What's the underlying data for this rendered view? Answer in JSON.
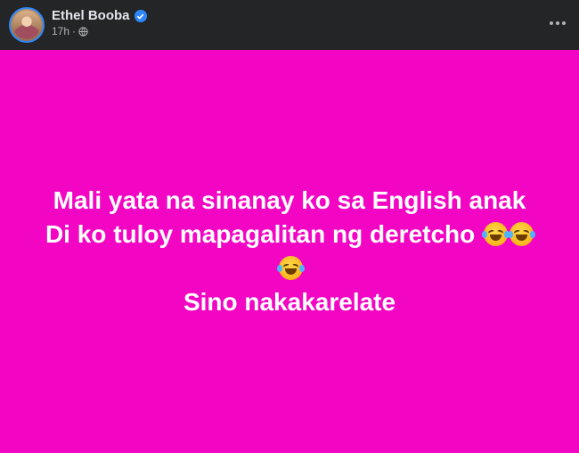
{
  "post": {
    "author": "Ethel Booba",
    "timestamp": "17h",
    "audience_icon": "globe-icon",
    "verified_icon": "verified-badge-icon",
    "background_color": "#f205c3",
    "lines": [
      "Mali yata na sinanay ko sa English anak",
      "Di ko tuloy mapagalitan ng deretcho",
      "Sino nakakarelate"
    ],
    "emoji_name": "rolling-on-the-floor-laughing-emoji"
  }
}
